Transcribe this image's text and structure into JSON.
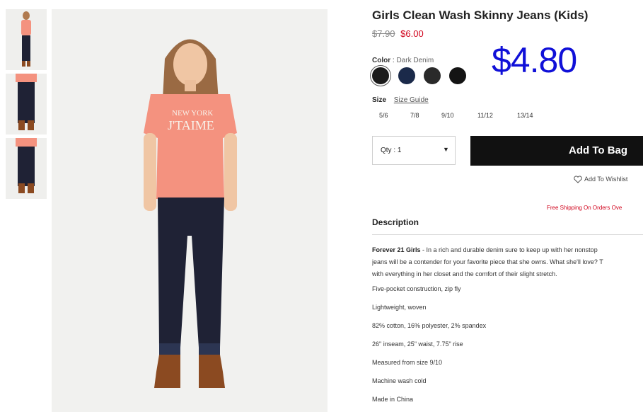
{
  "product": {
    "title": "Girls Clean Wash Skinny Jeans (Kids)",
    "original_price": "$7.90",
    "sale_price": "$6.00",
    "overlay_price": "$4.80"
  },
  "color": {
    "label": "Color",
    "separator": ":",
    "selected": "Dark Denim",
    "swatches": [
      {
        "name": "Black",
        "hex": "#1b1b1b",
        "selected": true
      },
      {
        "name": "Navy",
        "hex": "#1b2a4a",
        "selected": false
      },
      {
        "name": "Charcoal",
        "hex": "#2a2a2a",
        "selected": false
      },
      {
        "name": "Jet",
        "hex": "#141414",
        "selected": false
      }
    ]
  },
  "size": {
    "label": "Size",
    "guide_label": "Size Guide",
    "options": [
      "5/6",
      "7/8",
      "9/10",
      "11/12",
      "13/14"
    ]
  },
  "cart": {
    "qty_label": "Qty : 1",
    "qty_caret": "▼",
    "add_to_bag": "Add To Bag",
    "wishlist": "Add To Wishlist",
    "shipping_note": "Free Shipping On Orders Ove"
  },
  "description": {
    "heading": "Description",
    "brand": "Forever 21 Girls",
    "line1_rest": " - In a rich and durable denim sure to keep up with her nonstop",
    "line2": "jeans will be a contender for your favorite piece that she owns. What she'll love? T",
    "line3": "with everything in her closet and the comfort of their slight stretch.",
    "bullets": [
      "Five-pocket construction, zip fly",
      "Lightweight, woven",
      "82% cotton, 16% polyester, 2% spandex",
      "26\" inseam, 25\" waist, 7.75\" rise",
      "Measured from size 9/10",
      "Machine wash cold",
      "Made in China"
    ]
  },
  "colors": {
    "accent_red": "#d0021b",
    "overlay_blue": "#1010d8",
    "button_black": "#111111",
    "shirt_pink": "#f4927f",
    "denim": "#1f2235"
  },
  "icons": [
    "heart-outline-icon",
    "caret-down-icon"
  ]
}
